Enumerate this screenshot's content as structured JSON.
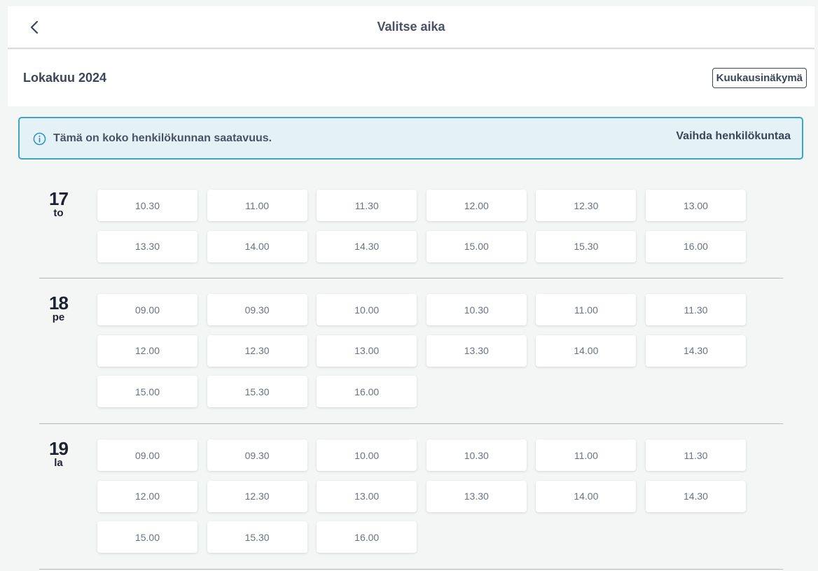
{
  "header": {
    "title": "Valitse aika"
  },
  "month": {
    "title": "Lokakuu 2024",
    "view_button": "Kuukausinäkymä"
  },
  "info": {
    "text": "Tämä on koko henkilökunnan saatavuus.",
    "link": "Vaihda henkilökuntaa"
  },
  "days": [
    {
      "num": "17",
      "name": "to",
      "slots": [
        "10.30",
        "11.00",
        "11.30",
        "12.00",
        "12.30",
        "13.00",
        "13.30",
        "14.00",
        "14.30",
        "15.00",
        "15.30",
        "16.00"
      ]
    },
    {
      "num": "18",
      "name": "pe",
      "slots": [
        "09.00",
        "09.30",
        "10.00",
        "10.30",
        "11.00",
        "11.30",
        "12.00",
        "12.30",
        "13.00",
        "13.30",
        "14.00",
        "14.30",
        "15.00",
        "15.30",
        "16.00"
      ]
    },
    {
      "num": "19",
      "name": "la",
      "slots": [
        "09.00",
        "09.30",
        "10.00",
        "10.30",
        "11.00",
        "11.30",
        "12.00",
        "12.30",
        "13.00",
        "13.30",
        "14.00",
        "14.30",
        "15.00",
        "15.30",
        "16.00"
      ]
    }
  ],
  "colors": {
    "accent": "#3ea3c9",
    "info_bg": "#e4f1f6",
    "page_bg": "#f4f5f5"
  },
  "icons": {
    "back": "chevron-left-icon",
    "info": "info-circle-icon"
  }
}
